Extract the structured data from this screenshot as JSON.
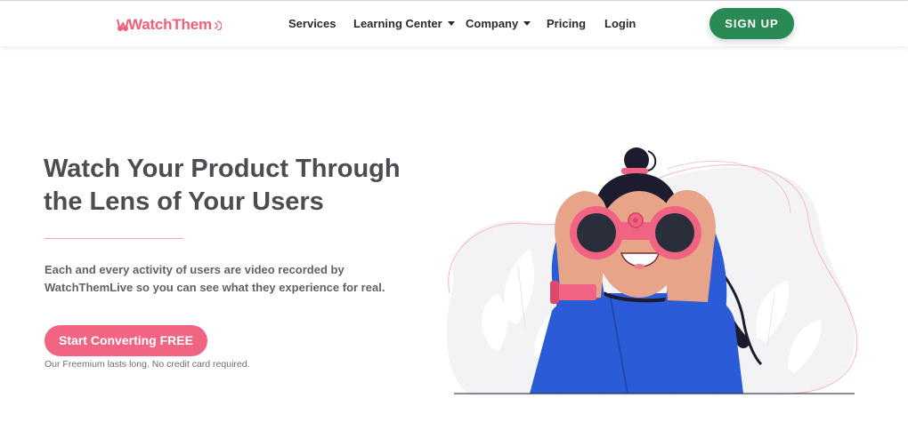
{
  "brand": {
    "name": "WatchThem",
    "color": "#f0607b"
  },
  "nav": {
    "items": [
      {
        "label": "Services",
        "dropdown": false
      },
      {
        "label": "Learning Center",
        "dropdown": true
      },
      {
        "label": "Company",
        "dropdown": true
      },
      {
        "label": "Pricing",
        "dropdown": false
      },
      {
        "label": "Login",
        "dropdown": false
      }
    ],
    "signup_label": "SIGN UP",
    "signup_color": "#2a8a55"
  },
  "hero": {
    "title": "Watch Your Product Through the Lens of Your Users",
    "description": "Each and every activity of users are video recorded by WatchThemLive so you can see what they experience for real.",
    "cta_label": "Start Converting FREE",
    "cta_color": "#f16582",
    "cta_note": "Our Freemium lasts long. No credit card required."
  },
  "illustration": {
    "subject": "woman-with-binoculars",
    "accent": "#f06383",
    "shirt": "#2b5bd6"
  }
}
